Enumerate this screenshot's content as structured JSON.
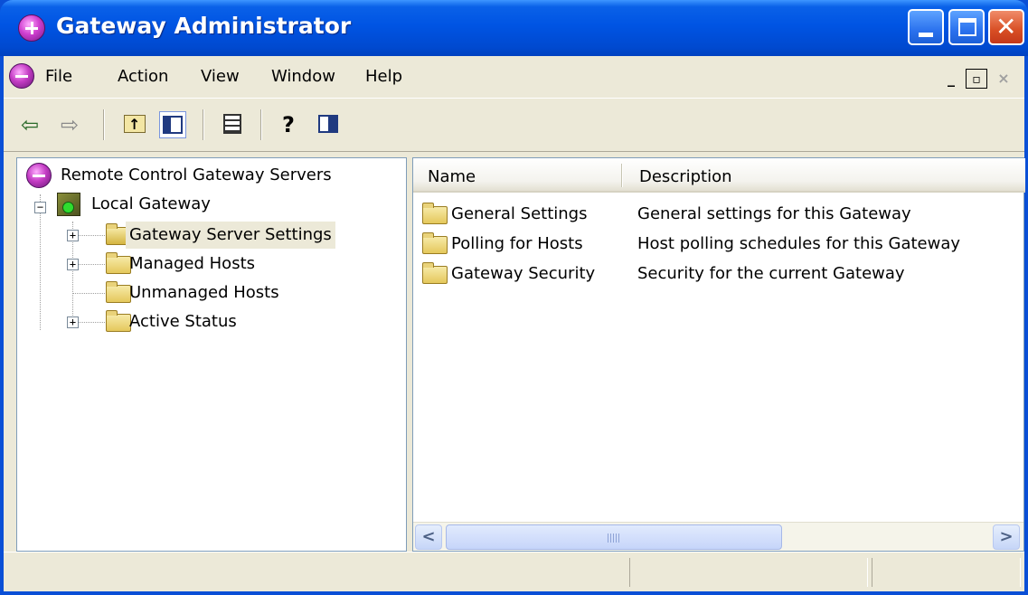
{
  "window": {
    "title": "Gateway Administrator"
  },
  "menu": {
    "items": [
      "File",
      "Action",
      "View",
      "Window",
      "Help"
    ]
  },
  "toolbar": {
    "icons": [
      "back-arrow-icon",
      "forward-arrow-icon",
      "up-folder-icon",
      "show-hide-tree-icon",
      "export-list-icon",
      "help-icon",
      "show-hide-action-pane-icon"
    ]
  },
  "tree": {
    "root": "Remote Control Gateway Servers",
    "gateway": "Local Gateway",
    "children": [
      {
        "label": "Gateway Server Settings",
        "expandable": true,
        "selected": true
      },
      {
        "label": "Managed Hosts",
        "expandable": true,
        "selected": false
      },
      {
        "label": "Unmanaged Hosts",
        "expandable": false,
        "selected": false
      },
      {
        "label": "Active Status",
        "expandable": true,
        "selected": false
      }
    ]
  },
  "list": {
    "columns": [
      "Name",
      "Description"
    ],
    "rows": [
      {
        "name": "General Settings",
        "description": "General settings for this Gateway"
      },
      {
        "name": "Polling for Hosts",
        "description": "Host polling schedules for this Gateway"
      },
      {
        "name": "Gateway Security",
        "description": "Security for the current Gateway"
      }
    ]
  },
  "glyphs": {
    "back": "⇦",
    "forward": "⇨",
    "help": "?",
    "minus": "−",
    "plus": "+",
    "close": "✕",
    "scroll_left": "<",
    "scroll_right": ">",
    "mdi_min": "_",
    "mdi_restore": "▫",
    "mdi_close": "×"
  },
  "colors": {
    "titlebar": "#0054e3",
    "window_face": "#ece9d8",
    "selection": "#ece9d8",
    "pane_border": "#7f9db9"
  }
}
